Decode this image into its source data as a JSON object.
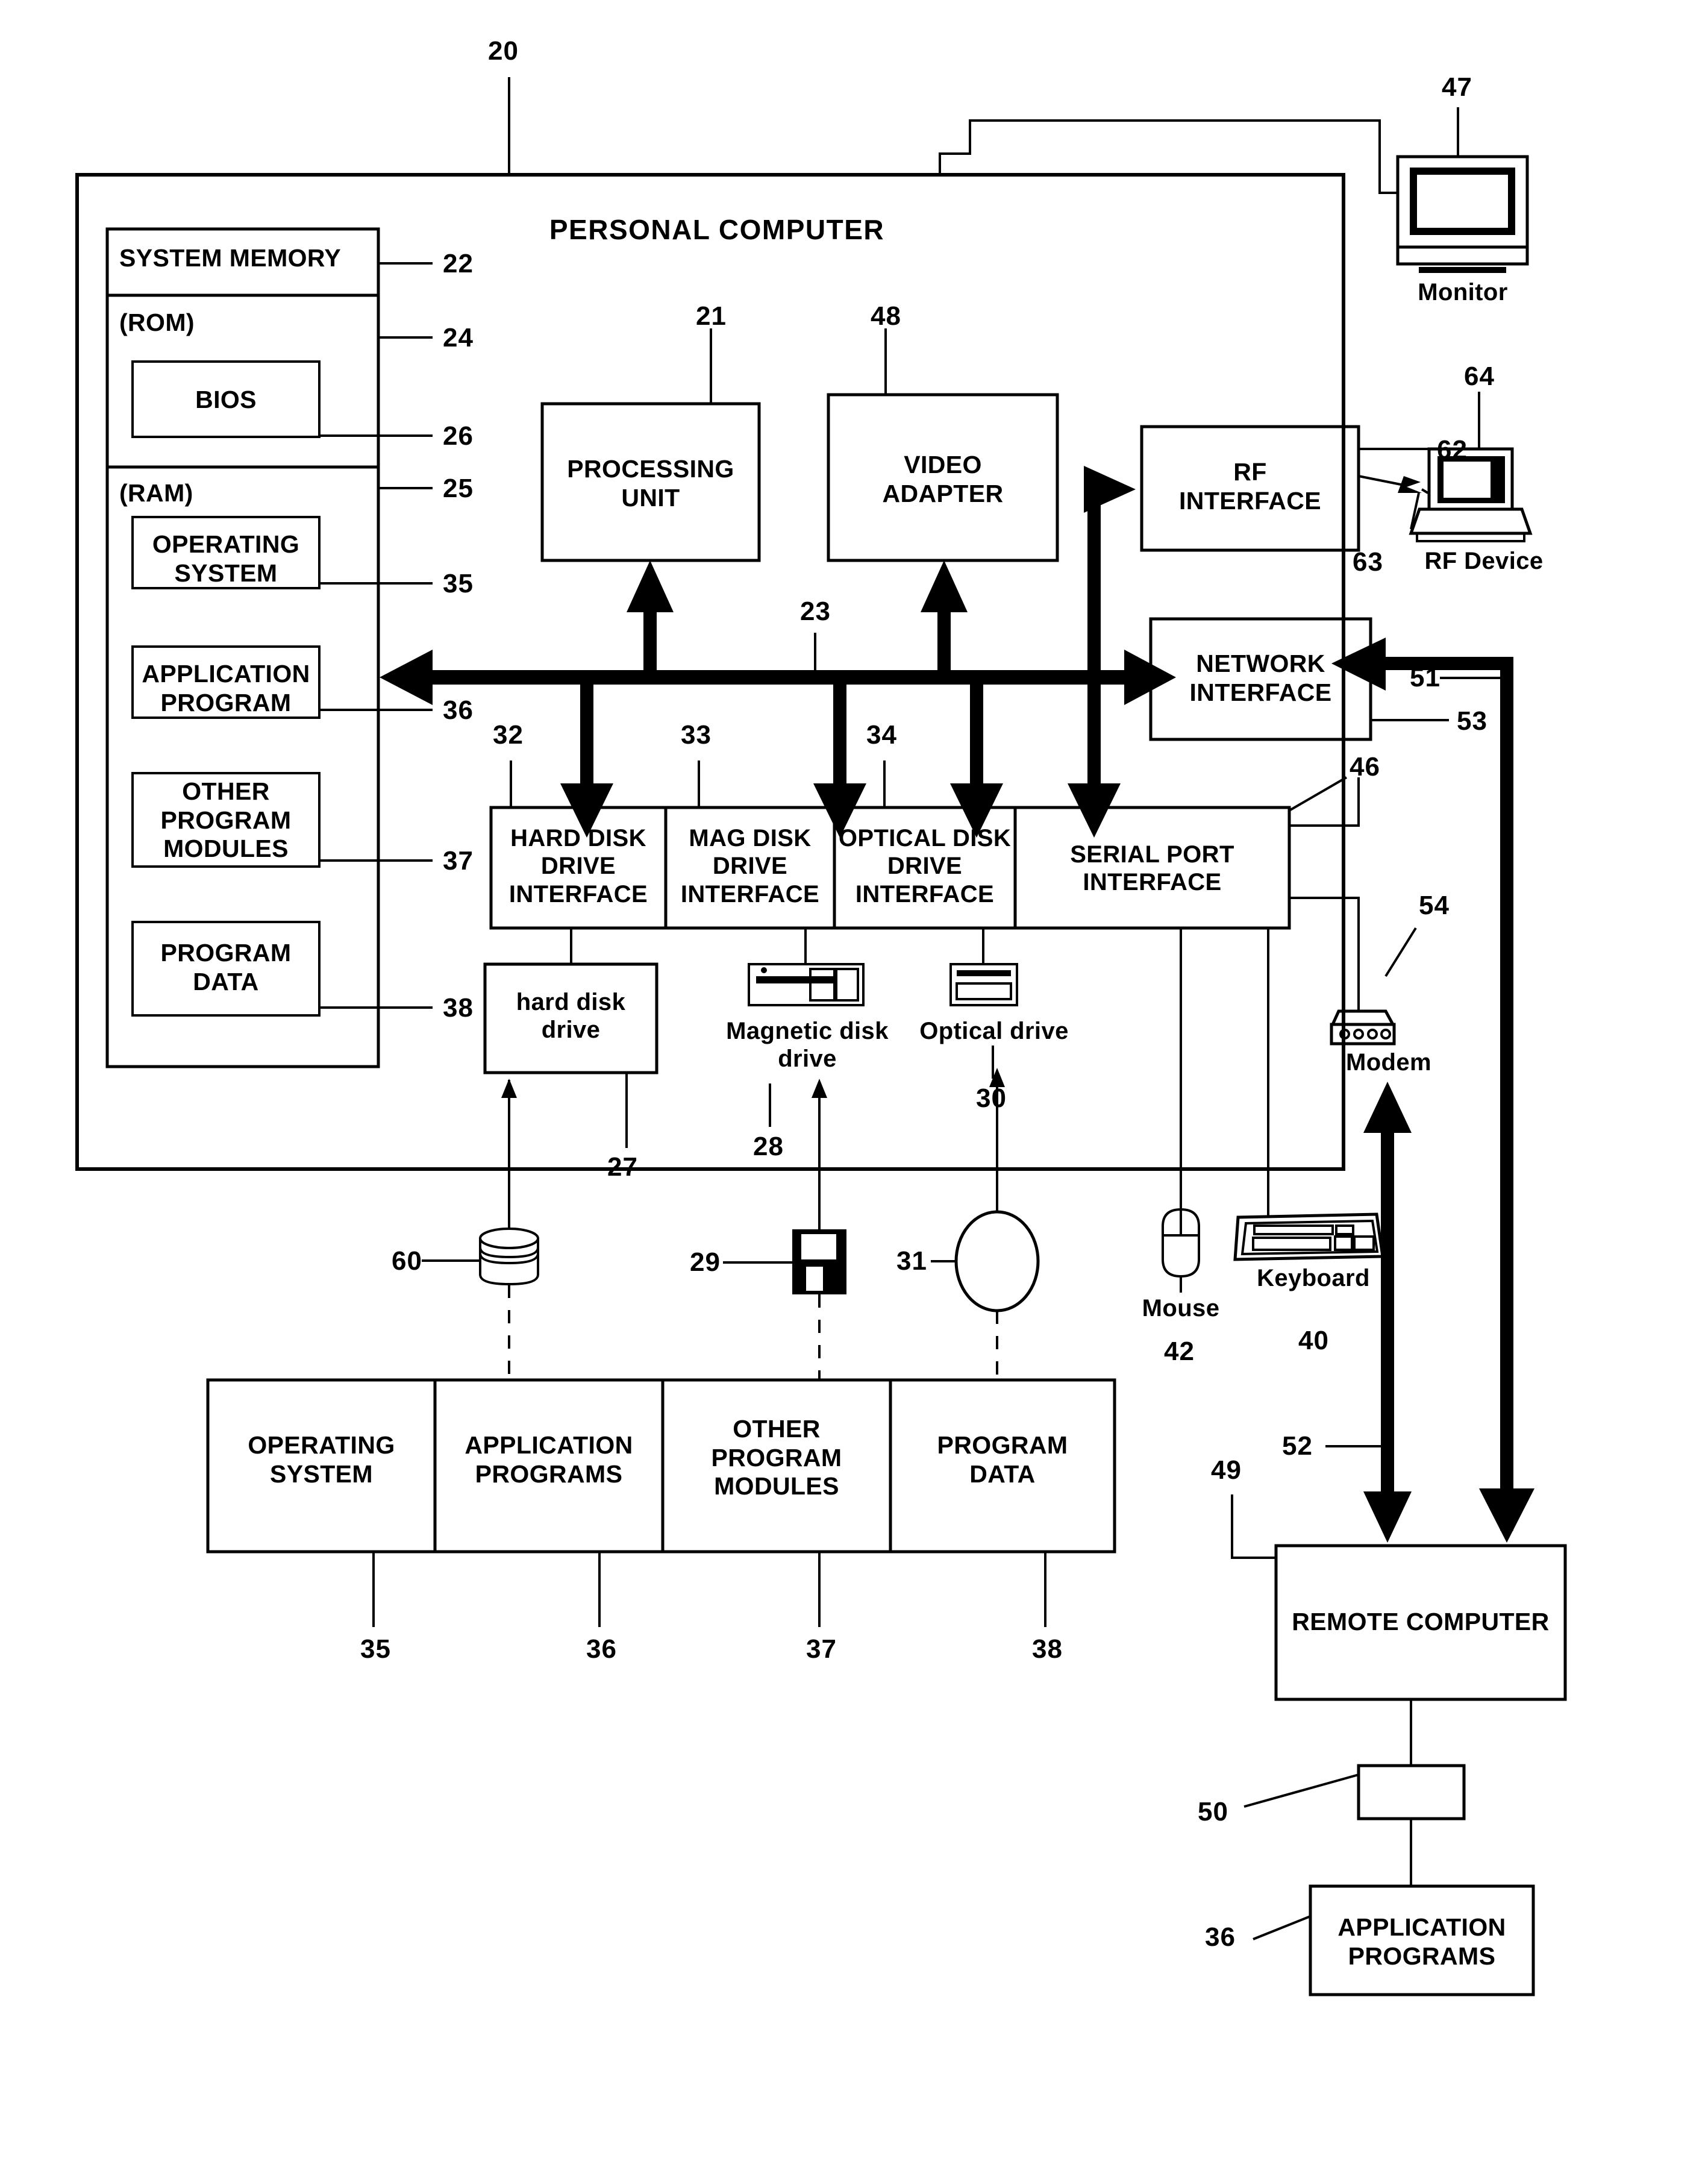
{
  "figure": {
    "title": "PERSONAL COMPUTER",
    "root_ref": "20"
  },
  "memory": {
    "system_memory_label": "SYSTEM MEMORY",
    "system_memory_ref": "22",
    "rom_label": "(ROM)",
    "rom_ref": "24",
    "bios_label": "BIOS",
    "bios_ref": "26",
    "ram_label": "(RAM)",
    "ram_ref": "25",
    "blocks": [
      {
        "label": "OPERATING\nSYSTEM",
        "ref": "35"
      },
      {
        "label": "APPLICATION\nPROGRAM",
        "ref": "36"
      },
      {
        "label": "OTHER\nPROGRAM\nMODULES",
        "ref": "37"
      },
      {
        "label": "PROGRAM\nDATA",
        "ref": "38"
      }
    ]
  },
  "core": {
    "processing_unit": {
      "label": "PROCESSING\nUNIT",
      "ref": "21"
    },
    "video_adapter": {
      "label": "VIDEO\nADAPTER",
      "ref": "48"
    },
    "rf_interface": {
      "label": "RF\nINTERFACE",
      "ref": "62"
    },
    "network_interface": {
      "label": "NETWORK\nINTERFACE",
      "ref": "53"
    },
    "system_bus_ref": "23"
  },
  "interfaces": [
    {
      "label": "HARD DISK\nDRIVE\nINTERFACE",
      "ref": "32"
    },
    {
      "label": "MAG DISK\nDRIVE\nINTERFACE",
      "ref": "33"
    },
    {
      "label": "OPTICAL DISK\nDRIVE\nINTERFACE",
      "ref": "34"
    },
    {
      "label": "SERIAL PORT\nINTERFACE",
      "ref": "46"
    }
  ],
  "drives": {
    "hard_disk_drive": {
      "label": "hard disk\ndrive",
      "ref": "27"
    },
    "magnetic_disk_drive": {
      "label": "Magnetic disk\ndrive",
      "ref": "28"
    },
    "optical_drive": {
      "label": "Optical drive",
      "ref": "30"
    }
  },
  "media": {
    "hard_disk_platter_ref": "60",
    "floppy_disk_ref": "29",
    "optical_disc_ref": "31"
  },
  "peripherals": {
    "monitor": {
      "label": "Monitor",
      "ref": "47"
    },
    "rf_device": {
      "label": "RF Device",
      "ref": "64",
      "link_ref": "63"
    },
    "mouse": {
      "label": "Mouse",
      "ref": "42"
    },
    "keyboard": {
      "label": "Keyboard",
      "ref": "40"
    },
    "modem": {
      "label": "Modem",
      "ref": "54"
    }
  },
  "storage_blocks": [
    {
      "label": "OPERATING\nSYSTEM",
      "ref": "35"
    },
    {
      "label": "APPLICATION\nPROGRAMS",
      "ref": "36"
    },
    {
      "label": "OTHER\nPROGRAM\nMODULES",
      "ref": "37"
    },
    {
      "label": "PROGRAM\nDATA",
      "ref": "38"
    }
  ],
  "remote": {
    "remote_computer": {
      "label": "REMOTE COMPUTER",
      "ref": "49"
    },
    "memory_device_ref": "50",
    "application_programs": {
      "label": "APPLICATION\nPROGRAMS",
      "ref": "36"
    },
    "wan_ref": "51",
    "lan_ref": "52"
  }
}
